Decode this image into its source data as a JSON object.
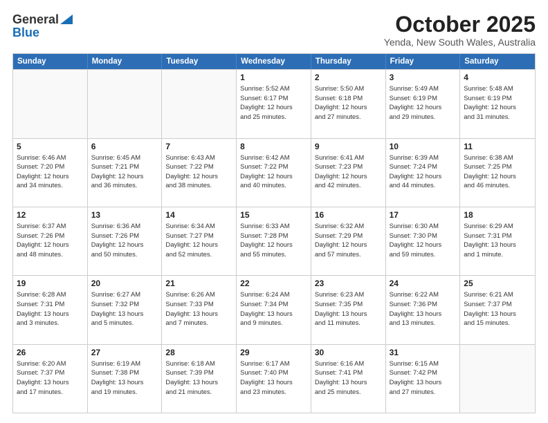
{
  "header": {
    "logo_general": "General",
    "logo_blue": "Blue",
    "month_title": "October 2025",
    "subtitle": "Yenda, New South Wales, Australia"
  },
  "weekdays": [
    "Sunday",
    "Monday",
    "Tuesday",
    "Wednesday",
    "Thursday",
    "Friday",
    "Saturday"
  ],
  "rows": [
    [
      {
        "day": "",
        "lines": [],
        "empty": true
      },
      {
        "day": "",
        "lines": [],
        "empty": true
      },
      {
        "day": "",
        "lines": [],
        "empty": true
      },
      {
        "day": "1",
        "lines": [
          "Sunrise: 5:52 AM",
          "Sunset: 6:17 PM",
          "Daylight: 12 hours",
          "and 25 minutes."
        ],
        "empty": false
      },
      {
        "day": "2",
        "lines": [
          "Sunrise: 5:50 AM",
          "Sunset: 6:18 PM",
          "Daylight: 12 hours",
          "and 27 minutes."
        ],
        "empty": false
      },
      {
        "day": "3",
        "lines": [
          "Sunrise: 5:49 AM",
          "Sunset: 6:19 PM",
          "Daylight: 12 hours",
          "and 29 minutes."
        ],
        "empty": false
      },
      {
        "day": "4",
        "lines": [
          "Sunrise: 5:48 AM",
          "Sunset: 6:19 PM",
          "Daylight: 12 hours",
          "and 31 minutes."
        ],
        "empty": false
      }
    ],
    [
      {
        "day": "5",
        "lines": [
          "Sunrise: 6:46 AM",
          "Sunset: 7:20 PM",
          "Daylight: 12 hours",
          "and 34 minutes."
        ],
        "empty": false
      },
      {
        "day": "6",
        "lines": [
          "Sunrise: 6:45 AM",
          "Sunset: 7:21 PM",
          "Daylight: 12 hours",
          "and 36 minutes."
        ],
        "empty": false
      },
      {
        "day": "7",
        "lines": [
          "Sunrise: 6:43 AM",
          "Sunset: 7:22 PM",
          "Daylight: 12 hours",
          "and 38 minutes."
        ],
        "empty": false
      },
      {
        "day": "8",
        "lines": [
          "Sunrise: 6:42 AM",
          "Sunset: 7:22 PM",
          "Daylight: 12 hours",
          "and 40 minutes."
        ],
        "empty": false
      },
      {
        "day": "9",
        "lines": [
          "Sunrise: 6:41 AM",
          "Sunset: 7:23 PM",
          "Daylight: 12 hours",
          "and 42 minutes."
        ],
        "empty": false
      },
      {
        "day": "10",
        "lines": [
          "Sunrise: 6:39 AM",
          "Sunset: 7:24 PM",
          "Daylight: 12 hours",
          "and 44 minutes."
        ],
        "empty": false
      },
      {
        "day": "11",
        "lines": [
          "Sunrise: 6:38 AM",
          "Sunset: 7:25 PM",
          "Daylight: 12 hours",
          "and 46 minutes."
        ],
        "empty": false
      }
    ],
    [
      {
        "day": "12",
        "lines": [
          "Sunrise: 6:37 AM",
          "Sunset: 7:26 PM",
          "Daylight: 12 hours",
          "and 48 minutes."
        ],
        "empty": false
      },
      {
        "day": "13",
        "lines": [
          "Sunrise: 6:36 AM",
          "Sunset: 7:26 PM",
          "Daylight: 12 hours",
          "and 50 minutes."
        ],
        "empty": false
      },
      {
        "day": "14",
        "lines": [
          "Sunrise: 6:34 AM",
          "Sunset: 7:27 PM",
          "Daylight: 12 hours",
          "and 52 minutes."
        ],
        "empty": false
      },
      {
        "day": "15",
        "lines": [
          "Sunrise: 6:33 AM",
          "Sunset: 7:28 PM",
          "Daylight: 12 hours",
          "and 55 minutes."
        ],
        "empty": false
      },
      {
        "day": "16",
        "lines": [
          "Sunrise: 6:32 AM",
          "Sunset: 7:29 PM",
          "Daylight: 12 hours",
          "and 57 minutes."
        ],
        "empty": false
      },
      {
        "day": "17",
        "lines": [
          "Sunrise: 6:30 AM",
          "Sunset: 7:30 PM",
          "Daylight: 12 hours",
          "and 59 minutes."
        ],
        "empty": false
      },
      {
        "day": "18",
        "lines": [
          "Sunrise: 6:29 AM",
          "Sunset: 7:31 PM",
          "Daylight: 13 hours",
          "and 1 minute."
        ],
        "empty": false
      }
    ],
    [
      {
        "day": "19",
        "lines": [
          "Sunrise: 6:28 AM",
          "Sunset: 7:31 PM",
          "Daylight: 13 hours",
          "and 3 minutes."
        ],
        "empty": false
      },
      {
        "day": "20",
        "lines": [
          "Sunrise: 6:27 AM",
          "Sunset: 7:32 PM",
          "Daylight: 13 hours",
          "and 5 minutes."
        ],
        "empty": false
      },
      {
        "day": "21",
        "lines": [
          "Sunrise: 6:26 AM",
          "Sunset: 7:33 PM",
          "Daylight: 13 hours",
          "and 7 minutes."
        ],
        "empty": false
      },
      {
        "day": "22",
        "lines": [
          "Sunrise: 6:24 AM",
          "Sunset: 7:34 PM",
          "Daylight: 13 hours",
          "and 9 minutes."
        ],
        "empty": false
      },
      {
        "day": "23",
        "lines": [
          "Sunrise: 6:23 AM",
          "Sunset: 7:35 PM",
          "Daylight: 13 hours",
          "and 11 minutes."
        ],
        "empty": false
      },
      {
        "day": "24",
        "lines": [
          "Sunrise: 6:22 AM",
          "Sunset: 7:36 PM",
          "Daylight: 13 hours",
          "and 13 minutes."
        ],
        "empty": false
      },
      {
        "day": "25",
        "lines": [
          "Sunrise: 6:21 AM",
          "Sunset: 7:37 PM",
          "Daylight: 13 hours",
          "and 15 minutes."
        ],
        "empty": false
      }
    ],
    [
      {
        "day": "26",
        "lines": [
          "Sunrise: 6:20 AM",
          "Sunset: 7:37 PM",
          "Daylight: 13 hours",
          "and 17 minutes."
        ],
        "empty": false
      },
      {
        "day": "27",
        "lines": [
          "Sunrise: 6:19 AM",
          "Sunset: 7:38 PM",
          "Daylight: 13 hours",
          "and 19 minutes."
        ],
        "empty": false
      },
      {
        "day": "28",
        "lines": [
          "Sunrise: 6:18 AM",
          "Sunset: 7:39 PM",
          "Daylight: 13 hours",
          "and 21 minutes."
        ],
        "empty": false
      },
      {
        "day": "29",
        "lines": [
          "Sunrise: 6:17 AM",
          "Sunset: 7:40 PM",
          "Daylight: 13 hours",
          "and 23 minutes."
        ],
        "empty": false
      },
      {
        "day": "30",
        "lines": [
          "Sunrise: 6:16 AM",
          "Sunset: 7:41 PM",
          "Daylight: 13 hours",
          "and 25 minutes."
        ],
        "empty": false
      },
      {
        "day": "31",
        "lines": [
          "Sunrise: 6:15 AM",
          "Sunset: 7:42 PM",
          "Daylight: 13 hours",
          "and 27 minutes."
        ],
        "empty": false
      },
      {
        "day": "",
        "lines": [],
        "empty": true
      }
    ]
  ]
}
